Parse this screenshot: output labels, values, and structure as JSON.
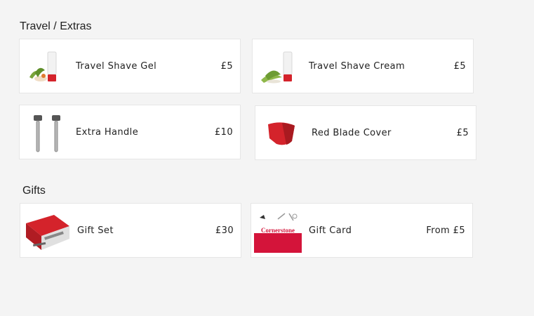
{
  "sections": [
    {
      "title": "Travel / Extras",
      "items": [
        {
          "name": "Travel Shave Gel",
          "price": "£5",
          "icon": "shave-gel-tube-icon"
        },
        {
          "name": "Travel Shave Cream",
          "price": "£5",
          "icon": "shave-cream-tube-icon"
        },
        {
          "name": "Extra Handle",
          "price": "£10",
          "icon": "razor-handle-icon"
        },
        {
          "name": "Red Blade Cover",
          "price": "£5",
          "icon": "blade-cover-icon"
        }
      ]
    },
    {
      "title": "Gifts",
      "items": [
        {
          "name": "Gift Set",
          "price": "£30",
          "icon": "gift-set-box-icon"
        },
        {
          "name": "Gift Card",
          "price": "From £5",
          "icon": "gift-card-icon"
        }
      ]
    }
  ],
  "gift_card_brand": "Cornerstone",
  "colors": {
    "accent_red": "#d4232b",
    "card_background": "#ffffff",
    "page_background": "#f4f4f4",
    "tube_white": "#f2f2f2",
    "leaf_green": "#7aa33a"
  }
}
